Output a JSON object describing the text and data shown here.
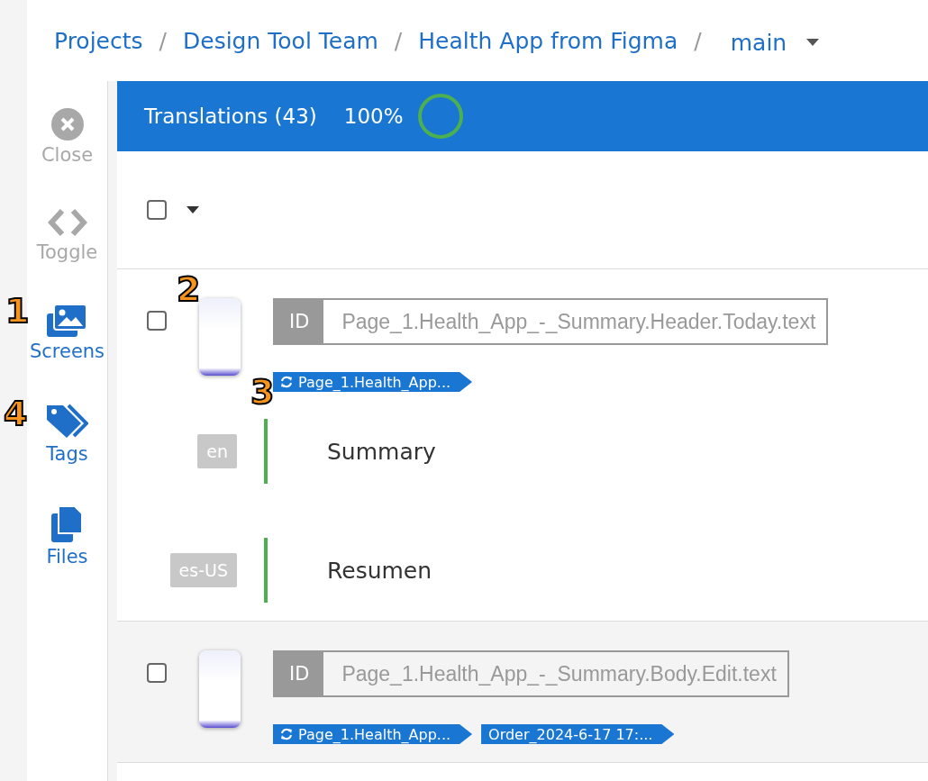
{
  "breadcrumb": {
    "items": [
      "Projects",
      "Design Tool Team",
      "Health App from Figma"
    ],
    "branch": "main",
    "separator": "/"
  },
  "sidebar": {
    "items": [
      {
        "label": "Close",
        "kind": "close",
        "disabled": true
      },
      {
        "label": "Toggle",
        "kind": "toggle",
        "disabled": true
      },
      {
        "label": "Screens",
        "kind": "screens",
        "disabled": false
      },
      {
        "label": "Tags",
        "kind": "tags",
        "disabled": false
      },
      {
        "label": "Files",
        "kind": "files",
        "disabled": false
      }
    ]
  },
  "header": {
    "title": "Translations (43)",
    "percent": "100%",
    "level": 1
  },
  "toolbar": {
    "select_all_checked": false
  },
  "rows": [
    {
      "checked": false,
      "id_label": "ID",
      "id": "Page_1.Health_App_-_Summary.Header.Today.text",
      "tags": [
        {
          "kind": "screen",
          "label": "Page_1.Health_App..."
        }
      ],
      "translations": [
        {
          "lang": "en",
          "text": "Summary"
        },
        {
          "lang": "es-US",
          "text": "Resumen"
        }
      ]
    },
    {
      "checked": false,
      "id_label": "ID",
      "id": "Page_1.Health_App_-_Summary.Body.Edit.text",
      "tags": [
        {
          "kind": "screen",
          "label": "Page_1.Health_App..."
        },
        {
          "kind": "tag",
          "label": "Order_2024-6-17 17:..."
        }
      ],
      "translations": []
    }
  ],
  "callouts": [
    "1",
    "2",
    "3",
    "4"
  ]
}
